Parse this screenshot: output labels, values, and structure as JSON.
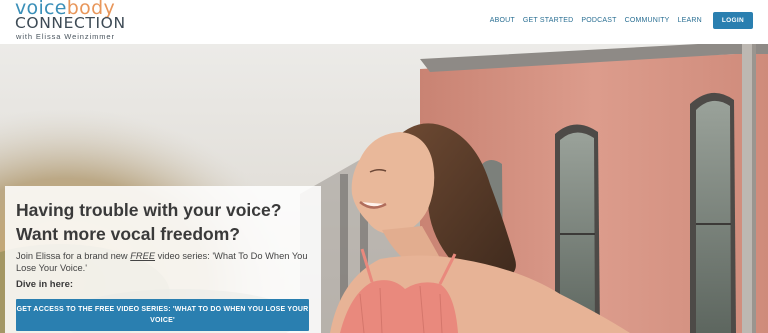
{
  "logo": {
    "word_voice": "voice",
    "word_body": "body",
    "word_connection": "CONNECTION",
    "tagline": "with Elissa Weinzimmer"
  },
  "nav": {
    "items": [
      {
        "label": "ABOUT"
      },
      {
        "label": "GET STARTED"
      },
      {
        "label": "PODCAST"
      },
      {
        "label": "COMMUNITY"
      },
      {
        "label": "LEARN"
      }
    ],
    "login_label": "LOGIN"
  },
  "hero": {
    "headline_1": "Having trouble with your voice?",
    "headline_2": "Want more vocal freedom?",
    "intro_before": "Join Elissa for a brand new ",
    "intro_free": "FREE",
    "intro_after": " video series: 'What To Do When You Lose Your Voice.'",
    "dive_in": "Dive in here:",
    "cta_label": "GET ACCESS TO THE FREE VIDEO SERIES: 'WHAT TO DO WHEN YOU LOSE YOUR VOICE'"
  },
  "colors": {
    "brand_blue": "#2a7fb0",
    "logo_orange": "#e8965a",
    "wall_pink": "#d89585"
  }
}
